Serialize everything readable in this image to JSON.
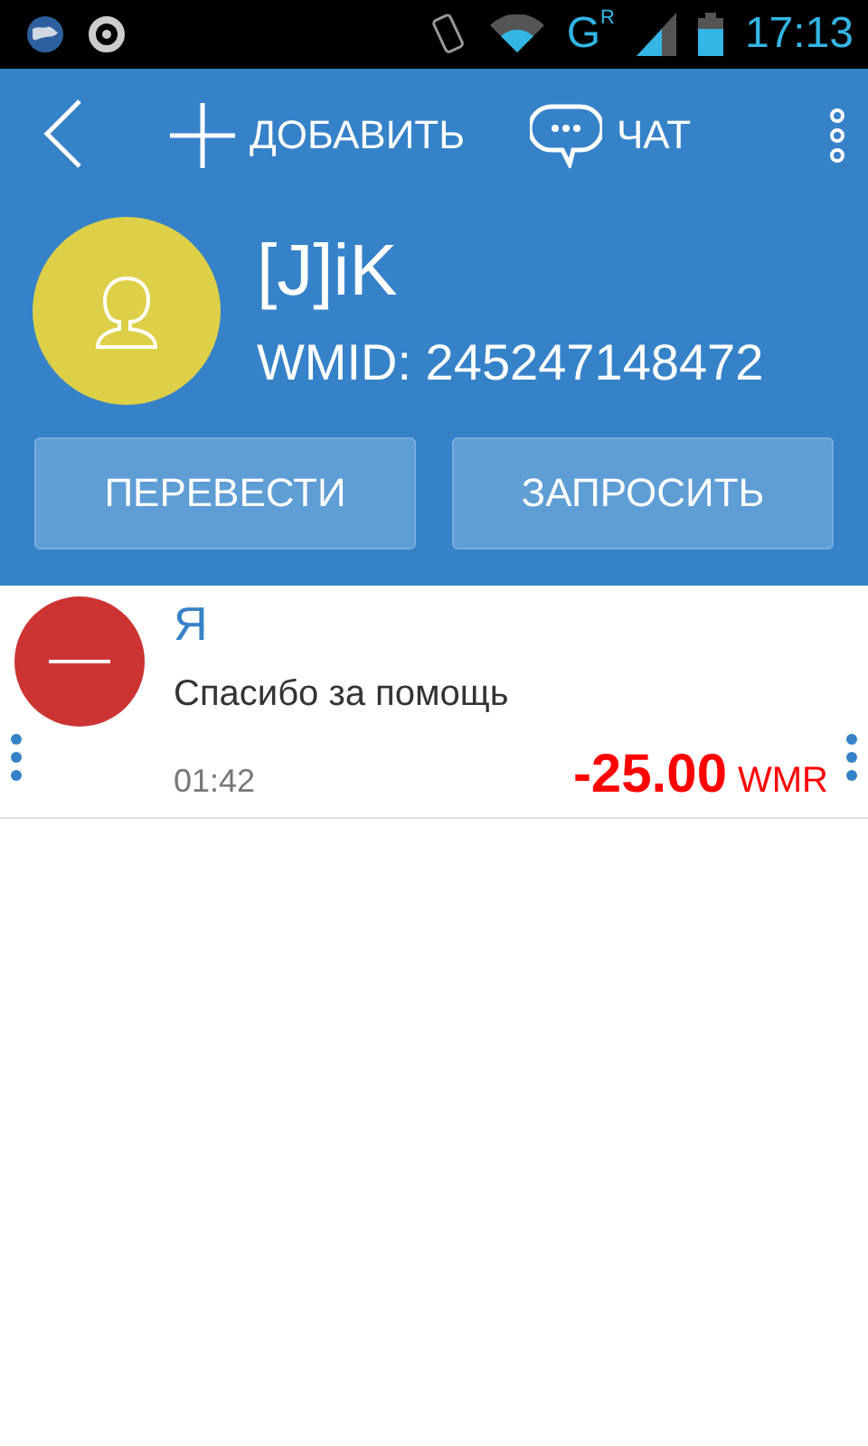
{
  "status_bar": {
    "time": "17:13",
    "network": "G",
    "roaming": "R"
  },
  "toolbar": {
    "add_label": "ДОБАВИТЬ",
    "chat_label": "ЧАТ"
  },
  "contact": {
    "name": "[J]iK",
    "wmid": "WMID: 245247148472"
  },
  "actions": [
    "ПЕРЕВЕСТИ",
    "ЗАПРОСИТЬ"
  ],
  "transactions": [
    {
      "kind": "outgoing",
      "sender": "Я",
      "note": "Спасибо за помощь",
      "time": "01:42",
      "amount": "-25.00",
      "currency": "WMR"
    }
  ]
}
